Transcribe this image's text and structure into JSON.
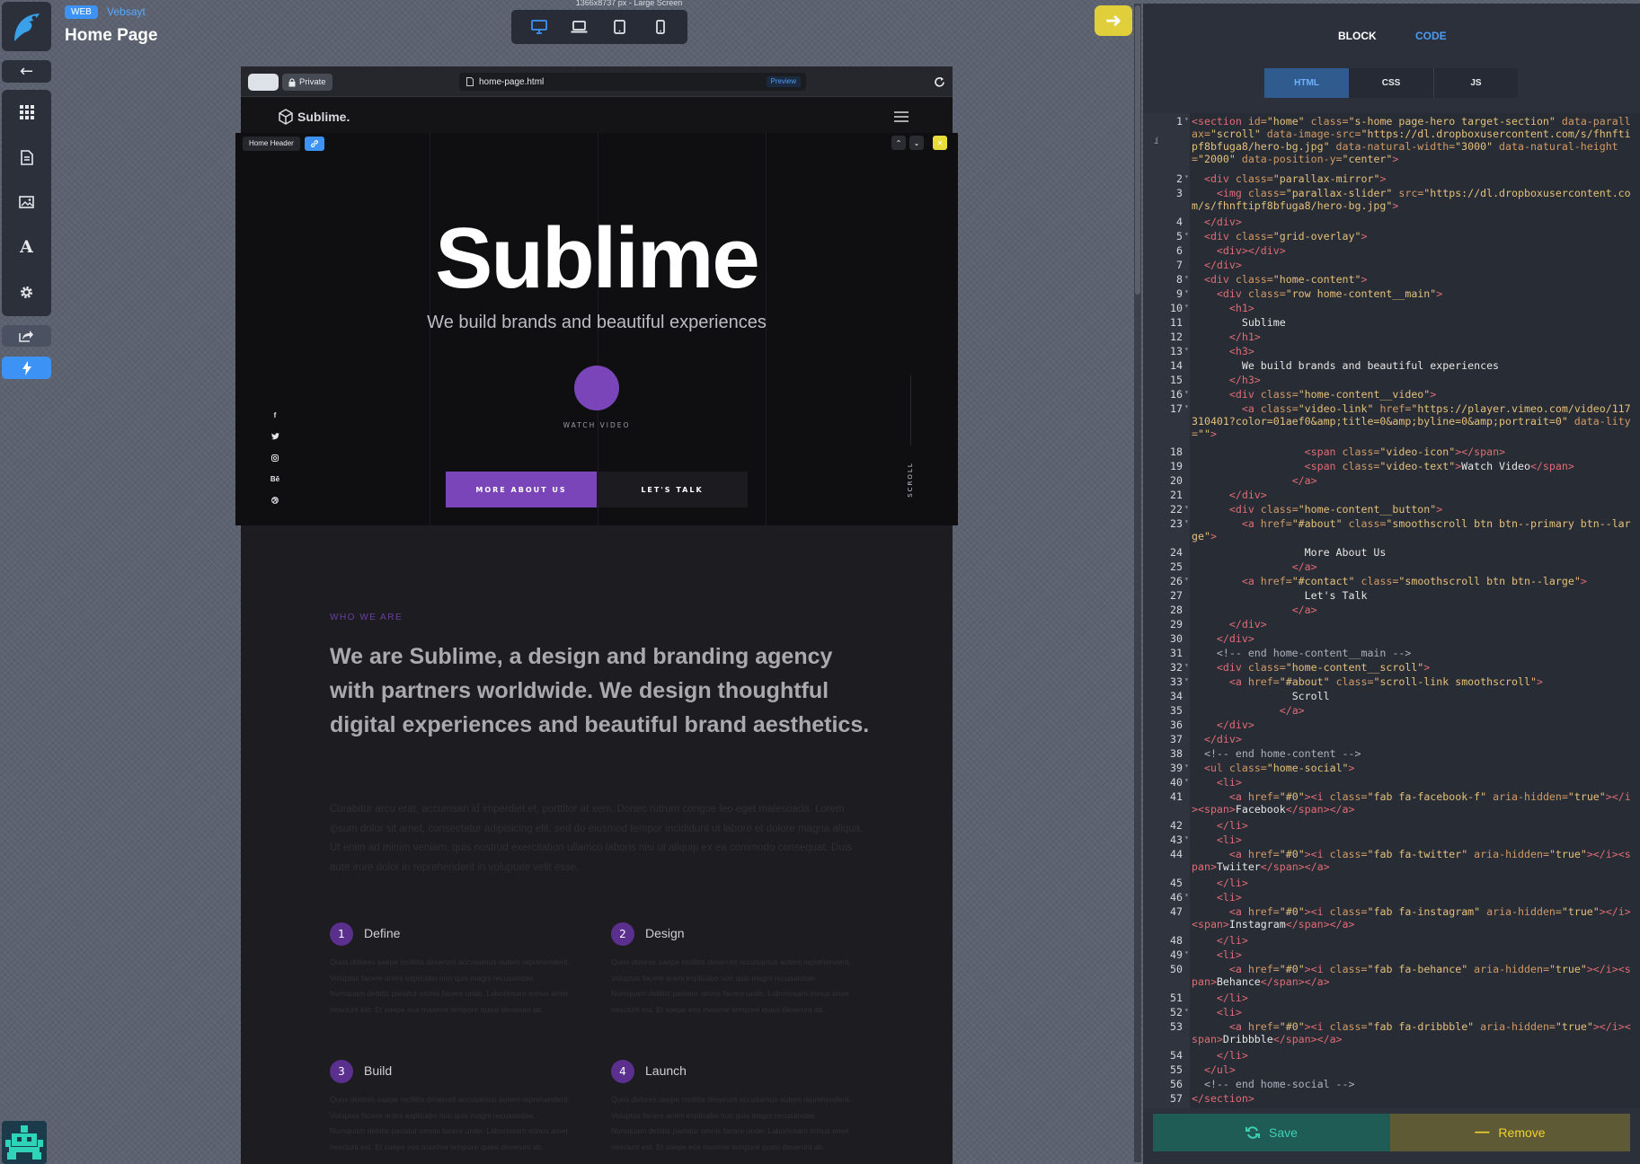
{
  "header": {
    "badge": "WEB",
    "project": "Vebsayt",
    "page_title": "Home Page",
    "screen_info": "1366x8737 px - Large Screen"
  },
  "preview": {
    "private_label": "Private",
    "url": "home-page.html",
    "preview_label": "Preview",
    "site_logo": "Sublime.",
    "block_tag": "Home Header"
  },
  "hero": {
    "title": "Sublime",
    "subtitle": "We build brands and beautiful experiences",
    "watch": "WATCH VIDEO",
    "btn_about": "MORE ABOUT US",
    "btn_talk": "LET'S TALK",
    "scroll": "SCROLL",
    "social": [
      "f",
      "t",
      "in",
      "Bē",
      "d"
    ]
  },
  "about": {
    "label": "WHO WE ARE",
    "heading": "We are Sublime, a design and branding agency with partners worldwide. We design thoughtful digital experiences and beautiful brand aesthetics.",
    "paragraph": "Curabitur arcu erat, accumsan id imperdiet et, porttitor at sem. Donec rutrum congue leo eget malesuada. Lorem ipsum dolor sit amet, consectetur adipisicing elit, sed do eiusmod tempor incididunt ut labore et dolore magna aliqua. Ut enim ad minim veniam, quis nostrud exercitation ullamco laboris nisi ut aliquip ex ea commodo consequat. Duis aute irure dolor in reprehenderit in voluptate velit esse.",
    "steps": [
      {
        "num": "1",
        "title": "Define",
        "text": "Quos dolores saepe mollitia deserunt accusamus autem reprehenderit. Voluptas facere animi explicabo non quis magni recusandae. Numquam debitis pariatur omnis facere unde. Laboriosam minus amet nesciunt est. Et saepe eos maxime tempore quasi deserunt ab."
      },
      {
        "num": "2",
        "title": "Design",
        "text": "Quos dolores saepe mollitia deserunt accusamus autem reprehenderit. Voluptas facere animi explicabo non quis magni recusandae. Numquam debitis pariatur omnis facere unde. Laboriosam minus amet nesciunt est. Et saepe eos maxime tempore quasi deserunt ab."
      },
      {
        "num": "3",
        "title": "Build",
        "text": "Quos dolores saepe mollitia deserunt accusamus autem reprehenderit. Voluptas facere animi explicabo non quis magni recusandae. Numquam debitis pariatur omnis facere unde. Laboriosam minus amet nesciunt est. Et saepe eos maxime tempore quasi deserunt ab."
      },
      {
        "num": "4",
        "title": "Launch",
        "text": "Quos dolores saepe mollitia deserunt accusamus autem reprehenderit. Voluptas facere animi explicabo non quis magni recusandae. Numquam debitis pariatur omnis facere unde. Laboriosam minus amet nesciunt est. Et saepe eos maxime tempore quasi deserunt ab."
      }
    ]
  },
  "panel": {
    "tab_block": "BLOCK",
    "tab_code": "CODE",
    "lang_tabs": [
      "HTML",
      "CSS",
      "JS"
    ],
    "save": "Save",
    "remove": "Remove",
    "code_lines": [
      {
        "n": "1",
        "fold": true,
        "html": "<span class='tg'>&lt;section</span> <span class='at'>id=</span><span class='st'>\"home\"</span> <span class='at'>class=</span><span class='st'>\"s-home page-hero target-section\"</span> <span class='at'>data-parallax=</span><span class='st'>\"scroll\"</span> <span class='at'>data-image-src=</span><span class='st'>\"https://dl.dropboxusercontent.com/s/fhnftipf8bfuga8/hero-bg.jpg\"</span> <span class='at'>data-natural-width=</span><span class='st'>\"3000\"</span> <span class='at'>data-natural-height=</span><span class='st'>\"2000\"</span> <span class='at'>data-position-y=</span><span class='st'>\"center\"</span><span class='tg'>&gt;</span>"
      },
      {
        "n": "2",
        "fold": true,
        "html": "  <span class='tg'>&lt;div</span> <span class='at'>class=</span><span class='st'>\"parallax-mirror\"</span><span class='tg'>&gt;</span>"
      },
      {
        "n": "3",
        "fold": false,
        "html": "    <span class='tg'>&lt;img</span> <span class='at'>class=</span><span class='st'>\"parallax-slider\"</span> <span class='at'>src=</span><span class='st'>\"https://dl.dropboxusercontent.com/s/fhnftipf8bfuga8/hero-bg.jpg\"</span><span class='tg'>&gt;</span>"
      },
      {
        "n": "4",
        "fold": false,
        "html": "  <span class='tg'>&lt;/div&gt;</span>"
      },
      {
        "n": "5",
        "fold": true,
        "html": "  <span class='tg'>&lt;div</span> <span class='at'>class=</span><span class='st'>\"grid-overlay\"</span><span class='tg'>&gt;</span>"
      },
      {
        "n": "6",
        "fold": false,
        "html": "    <span class='tg'>&lt;div&gt;&lt;/div&gt;</span>"
      },
      {
        "n": "7",
        "fold": false,
        "html": "  <span class='tg'>&lt;/div&gt;</span>"
      },
      {
        "n": "8",
        "fold": true,
        "html": "  <span class='tg'>&lt;div</span> <span class='at'>class=</span><span class='st'>\"home-content\"</span><span class='tg'>&gt;</span>"
      },
      {
        "n": "9",
        "fold": true,
        "html": "    <span class='tg'>&lt;div</span> <span class='at'>class=</span><span class='st'>\"row home-content__main\"</span><span class='tg'>&gt;</span>"
      },
      {
        "n": "10",
        "fold": true,
        "html": "      <span class='tg'>&lt;h1&gt;</span>"
      },
      {
        "n": "11",
        "fold": false,
        "html": "        Sublime"
      },
      {
        "n": "12",
        "fold": false,
        "html": "      <span class='tg'>&lt;/h1&gt;</span>"
      },
      {
        "n": "13",
        "fold": true,
        "html": "      <span class='tg'>&lt;h3&gt;</span>"
      },
      {
        "n": "14",
        "fold": false,
        "html": "        We build brands and beautiful experiences"
      },
      {
        "n": "15",
        "fold": false,
        "html": "      <span class='tg'>&lt;/h3&gt;</span>"
      },
      {
        "n": "16",
        "fold": true,
        "html": "      <span class='tg'>&lt;div</span> <span class='at'>class=</span><span class='st'>\"home-content__video\"</span><span class='tg'>&gt;</span>"
      },
      {
        "n": "17",
        "fold": true,
        "html": "        <span class='tg'>&lt;a</span> <span class='at'>class=</span><span class='st'>\"video-link\"</span> <span class='at'>href=</span><span class='st'>\"https://player.vimeo.com/video/117310401?color=01aef0&amp;amp;title=0&amp;amp;byline=0&amp;amp;portrait=0\"</span> <span class='at'>data-lity=</span><span class='st'>\"\"</span><span class='tg'>&gt;</span>"
      },
      {
        "n": "18",
        "fold": false,
        "html": "                  <span class='tg'>&lt;span</span> <span class='at'>class=</span><span class='st'>\"video-icon\"</span><span class='tg'>&gt;&lt;/span&gt;</span>"
      },
      {
        "n": "19",
        "fold": false,
        "html": "                  <span class='tg'>&lt;span</span> <span class='at'>class=</span><span class='st'>\"video-text\"</span><span class='tg'>&gt;</span>Watch Video<span class='tg'>&lt;/span&gt;</span>"
      },
      {
        "n": "20",
        "fold": false,
        "html": "                <span class='tg'>&lt;/a&gt;</span>"
      },
      {
        "n": "21",
        "fold": false,
        "html": "      <span class='tg'>&lt;/div&gt;</span>"
      },
      {
        "n": "22",
        "fold": true,
        "html": "      <span class='tg'>&lt;div</span> <span class='at'>class=</span><span class='st'>\"home-content__button\"</span><span class='tg'>&gt;</span>"
      },
      {
        "n": "23",
        "fold": true,
        "html": "        <span class='tg'>&lt;a</span> <span class='at'>href=</span><span class='st'>\"#about\"</span> <span class='at'>class=</span><span class='st'>\"smoothscroll btn btn--primary btn--large\"</span><span class='tg'>&gt;</span>"
      },
      {
        "n": "24",
        "fold": false,
        "html": "                  More About Us"
      },
      {
        "n": "25",
        "fold": false,
        "html": "                <span class='tg'>&lt;/a&gt;</span>"
      },
      {
        "n": "26",
        "fold": true,
        "html": "        <span class='tg'>&lt;a</span> <span class='at'>href=</span><span class='st'>\"#contact\"</span> <span class='at'>class=</span><span class='st'>\"smoothscroll btn btn--large\"</span><span class='tg'>&gt;</span>"
      },
      {
        "n": "27",
        "fold": false,
        "html": "                  Let's Talk"
      },
      {
        "n": "28",
        "fold": false,
        "html": "                <span class='tg'>&lt;/a&gt;</span>"
      },
      {
        "n": "29",
        "fold": false,
        "html": "      <span class='tg'>&lt;/div&gt;</span>"
      },
      {
        "n": "30",
        "fold": false,
        "html": "    <span class='tg'>&lt;/div&gt;</span>"
      },
      {
        "n": "31",
        "fold": false,
        "html": "    <span class='cm'>&lt;!-- end home-content__main --&gt;</span>"
      },
      {
        "n": "32",
        "fold": true,
        "html": "    <span class='tg'>&lt;div</span> <span class='at'>class=</span><span class='st'>\"home-content__scroll\"</span><span class='tg'>&gt;</span>"
      },
      {
        "n": "33",
        "fold": true,
        "html": "      <span class='tg'>&lt;a</span> <span class='at'>href=</span><span class='st'>\"#about\"</span> <span class='at'>class=</span><span class='st'>\"scroll-link smoothscroll\"</span><span class='tg'>&gt;</span>"
      },
      {
        "n": "34",
        "fold": false,
        "html": "                Scroll"
      },
      {
        "n": "35",
        "fold": false,
        "html": "              <span class='tg'>&lt;/a&gt;</span>"
      },
      {
        "n": "36",
        "fold": false,
        "html": "    <span class='tg'>&lt;/div&gt;</span>"
      },
      {
        "n": "37",
        "fold": false,
        "html": "  <span class='tg'>&lt;/div&gt;</span>"
      },
      {
        "n": "38",
        "fold": false,
        "html": "  <span class='cm'>&lt;!-- end home-content --&gt;</span>"
      },
      {
        "n": "39",
        "fold": true,
        "html": "  <span class='tg'>&lt;ul</span> <span class='at'>class=</span><span class='st'>\"home-social\"</span><span class='tg'>&gt;</span>"
      },
      {
        "n": "40",
        "fold": true,
        "html": "    <span class='tg'>&lt;li&gt;</span>"
      },
      {
        "n": "41",
        "fold": false,
        "html": "      <span class='tg'>&lt;a</span> <span class='at'>href=</span><span class='st'>\"#0\"</span><span class='tg'>&gt;&lt;i</span> <span class='at'>class=</span><span class='st'>\"fab fa-facebook-f\"</span> <span class='at'>aria-hidden=</span><span class='st'>\"true\"</span><span class='tg'>&gt;&lt;/i&gt;&lt;span&gt;</span>Facebook<span class='tg'>&lt;/span&gt;&lt;/a&gt;</span>"
      },
      {
        "n": "42",
        "fold": false,
        "html": "    <span class='tg'>&lt;/li&gt;</span>"
      },
      {
        "n": "43",
        "fold": true,
        "html": "    <span class='tg'>&lt;li&gt;</span>"
      },
      {
        "n": "44",
        "fold": false,
        "html": "      <span class='tg'>&lt;a</span> <span class='at'>href=</span><span class='st'>\"#0\"</span><span class='tg'>&gt;&lt;i</span> <span class='at'>class=</span><span class='st'>\"fab fa-twitter\"</span> <span class='at'>aria-hidden=</span><span class='st'>\"true\"</span><span class='tg'>&gt;&lt;/i&gt;&lt;span&gt;</span>Twiiter<span class='tg'>&lt;/span&gt;&lt;/a&gt;</span>"
      },
      {
        "n": "45",
        "fold": false,
        "html": "    <span class='tg'>&lt;/li&gt;</span>"
      },
      {
        "n": "46",
        "fold": true,
        "html": "    <span class='tg'>&lt;li&gt;</span>"
      },
      {
        "n": "47",
        "fold": false,
        "html": "      <span class='tg'>&lt;a</span> <span class='at'>href=</span><span class='st'>\"#0\"</span><span class='tg'>&gt;&lt;i</span> <span class='at'>class=</span><span class='st'>\"fab fa-instagram\"</span> <span class='at'>aria-hidden=</span><span class='st'>\"true\"</span><span class='tg'>&gt;&lt;/i&gt;&lt;span&gt;</span>Instagram<span class='tg'>&lt;/span&gt;&lt;/a&gt;</span>"
      },
      {
        "n": "48",
        "fold": false,
        "html": "    <span class='tg'>&lt;/li&gt;</span>"
      },
      {
        "n": "49",
        "fold": true,
        "html": "    <span class='tg'>&lt;li&gt;</span>"
      },
      {
        "n": "50",
        "fold": false,
        "html": "      <span class='tg'>&lt;a</span> <span class='at'>href=</span><span class='st'>\"#0\"</span><span class='tg'>&gt;&lt;i</span> <span class='at'>class=</span><span class='st'>\"fab fa-behance\"</span> <span class='at'>aria-hidden=</span><span class='st'>\"true\"</span><span class='tg'>&gt;&lt;/i&gt;&lt;span&gt;</span>Behance<span class='tg'>&lt;/span&gt;&lt;/a&gt;</span>"
      },
      {
        "n": "51",
        "fold": false,
        "html": "    <span class='tg'>&lt;/li&gt;</span>"
      },
      {
        "n": "52",
        "fold": true,
        "html": "    <span class='tg'>&lt;li&gt;</span>"
      },
      {
        "n": "53",
        "fold": false,
        "html": "      <span class='tg'>&lt;a</span> <span class='at'>href=</span><span class='st'>\"#0\"</span><span class='tg'>&gt;&lt;i</span> <span class='at'>class=</span><span class='st'>\"fab fa-dribbble\"</span> <span class='at'>aria-hidden=</span><span class='st'>\"true\"</span><span class='tg'>&gt;&lt;/i&gt;&lt;span&gt;</span>Dribbble<span class='tg'>&lt;/span&gt;&lt;/a&gt;</span>"
      },
      {
        "n": "54",
        "fold": false,
        "html": "    <span class='tg'>&lt;/li&gt;</span>"
      },
      {
        "n": "55",
        "fold": false,
        "html": "  <span class='tg'>&lt;/ul&gt;</span>"
      },
      {
        "n": "56",
        "fold": false,
        "html": "  <span class='cm'>&lt;!-- end home-social --&gt;</span>"
      },
      {
        "n": "57",
        "fold": false,
        "html": "<span class='tg'>&lt;/section&gt;</span>"
      }
    ]
  },
  "colors": {
    "accent_blue": "#3d93f5",
    "brand_purple": "#7a45b8",
    "arrow_yellow": "#e0cf3a"
  }
}
